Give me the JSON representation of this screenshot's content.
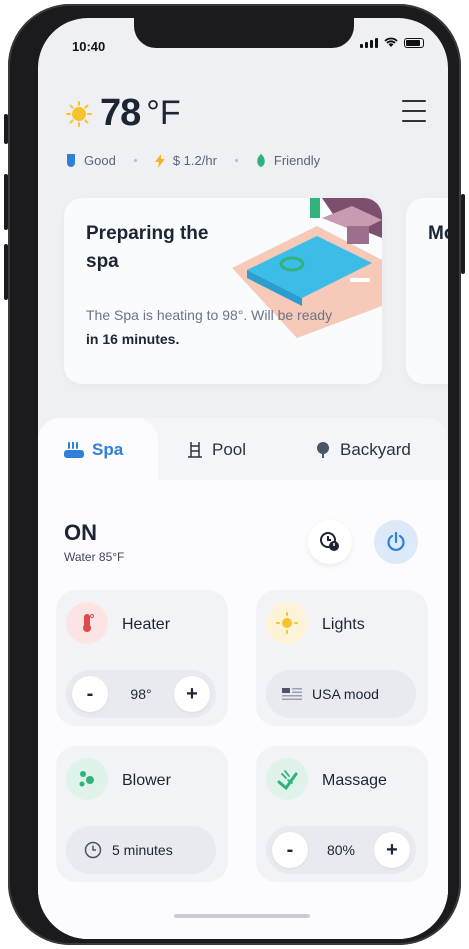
{
  "status": {
    "time": "10:40"
  },
  "weather": {
    "temperature": "78",
    "unit": "°F"
  },
  "info": {
    "water_quality": "Good",
    "cost": "$ 1.2/hr",
    "eco": "Friendly"
  },
  "cards": [
    {
      "title": "Preparing the spa",
      "desc_prefix": "The Spa is heating to 98°. Will be ready ",
      "desc_bold": "in 16 minutes."
    },
    {
      "title": "Mo pr"
    }
  ],
  "tabs": [
    {
      "label": "Spa",
      "active": true
    },
    {
      "label": "Pool",
      "active": false
    },
    {
      "label": "Backyard",
      "active": false
    }
  ],
  "spa": {
    "state": "ON",
    "water": "Water 85°F"
  },
  "tiles": {
    "heater": {
      "name": "Heater",
      "value": "98°",
      "minus": "-",
      "plus": "+"
    },
    "lights": {
      "name": "Lights",
      "mood": "USA mood"
    },
    "blower": {
      "name": "Blower",
      "timer": "5 minutes"
    },
    "massage": {
      "name": "Massage",
      "value": "80%",
      "minus": "-",
      "plus": "+"
    }
  },
  "colors": {
    "accent": "#2f80d8",
    "heater_bg": "#fde4e4",
    "lights_bg": "#fdf4d8",
    "blower_bg": "#dff3ea",
    "massage_bg": "#dff3ea"
  }
}
